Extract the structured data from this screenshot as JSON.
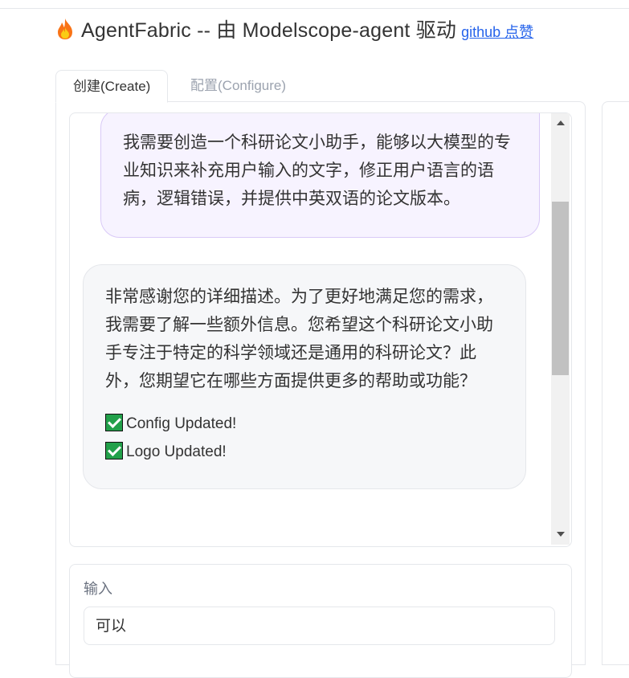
{
  "header": {
    "title": "AgentFabric -- 由 Modelscope-agent 驱动",
    "github_link": "github 点赞",
    "logo_icon": "fire-icon"
  },
  "tabs": [
    {
      "label": "创建(Create)",
      "active": true
    },
    {
      "label": "配置(Configure)",
      "active": false
    }
  ],
  "chat": {
    "messages": [
      {
        "role": "user",
        "text": "我需要创造一个科研论文小助手，能够以大模型的专业知识来补充用户输入的文字，修正用户语言的语病，逻辑错误，并提供中英双语的论文版本。"
      },
      {
        "role": "assistant",
        "text": "非常感谢您的详细描述。为了更好地满足您的需求，我需要了解一些额外信息。您希望这个科研论文小助手专注于特定的科学领域还是通用的科研论文？此外，您期望它在哪些方面提供更多的帮助或功能？",
        "status": [
          "Config Updated!",
          "Logo Updated!"
        ]
      }
    ]
  },
  "input": {
    "label": "输入",
    "value": "可以"
  },
  "colors": {
    "user_bubble": "#f7f3ff",
    "bot_bubble": "#f6f7f9",
    "link": "#2563eb",
    "check": "#22a04a"
  }
}
